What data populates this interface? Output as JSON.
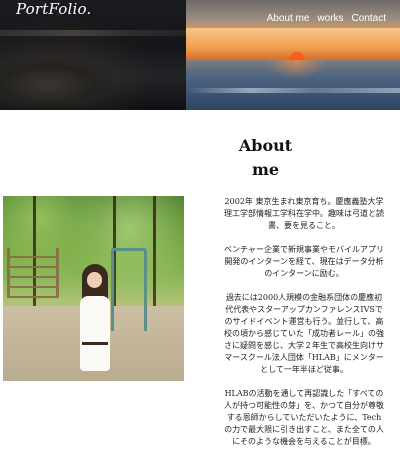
{
  "header": {
    "logo": "PortFolio.",
    "nav": [
      {
        "label": "About me"
      },
      {
        "label": "works"
      },
      {
        "label": "Contact"
      }
    ]
  },
  "about": {
    "title_line1": "About",
    "title_line2": "me",
    "paragraphs": [
      "2002年 東京生まれ東京育ち。慶應義塾大学理工学部情報工学科在学中。趣味は弓道と読書、要を見ること。",
      "ベンチャー企業で新規事業やモバイルアプリ開発のインターンを経て、現在はデータ分析のインターンに励む。",
      "過去には2000人規模の金融系団体の慶應初代代表やスターアップカンファレンスIVSでのサイドイベント運営も行う。並行して、高校の頃から感じていた「成功者レール」の強さに疑問を感じ、大学２年生で高校生向けサマースクール法人団体「HLAB」にメンターとして一年半ほど従事。",
      "HLABの活動を通して再認識した「すべての人が持つ可能性の芽」を、かつて自分が尊敬する恩師からしていただいたように、Techの力で最大限に引き出すこと、また全ての人にそのような機会を与えることが目標。"
    ]
  },
  "colors": {
    "nav_text": "#ffffff",
    "body_text": "#222222",
    "background": "#ffffff"
  }
}
